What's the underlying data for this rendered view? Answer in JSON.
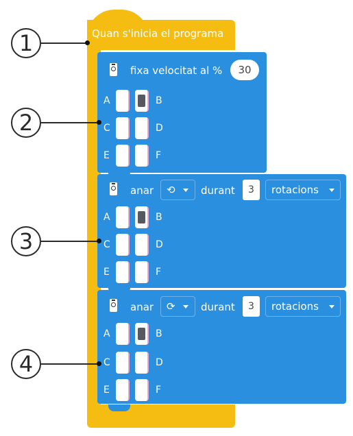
{
  "hat_block": {
    "label": "Quan s'inicia el programa"
  },
  "set_speed_block": {
    "label": "fixa velocitat al %",
    "value": "30",
    "ports": {
      "a": "A",
      "b": "B",
      "c": "C",
      "d": "D",
      "e": "E",
      "f": "F"
    },
    "selected_port": "B",
    "icon": "motor-icon"
  },
  "run_block_1": {
    "verb": "anar",
    "direction_icon": "counterclockwise-icon",
    "direction_glyph": "⟲",
    "connector": "durant",
    "amount": "3",
    "unit": "rotacions",
    "ports": {
      "a": "A",
      "b": "B",
      "c": "C",
      "d": "D",
      "e": "E",
      "f": "F"
    },
    "selected_port": "B",
    "icon": "motor-icon"
  },
  "run_block_2": {
    "verb": "anar",
    "direction_icon": "clockwise-icon",
    "direction_glyph": "⟳",
    "connector": "durant",
    "amount": "3",
    "unit": "rotacions",
    "ports": {
      "a": "A",
      "b": "B",
      "c": "C",
      "d": "D",
      "e": "E",
      "f": "F"
    },
    "selected_port": "B",
    "icon": "motor-icon"
  },
  "callouts": [
    "1",
    "2",
    "3",
    "4"
  ],
  "colors": {
    "event_yellow": "#F5BD12",
    "motor_blue": "#2B8FE0",
    "port_selected": "#555a62"
  }
}
